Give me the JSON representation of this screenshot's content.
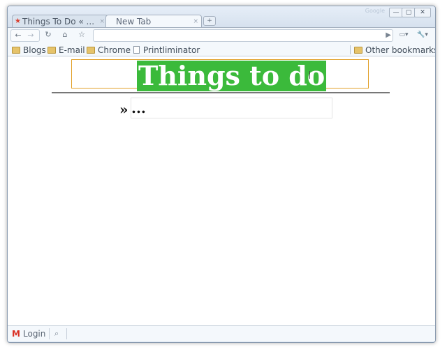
{
  "browser": {
    "brand": "Google",
    "tabs": [
      {
        "label": "Things To Do « ...",
        "close": "×"
      },
      {
        "label": "New Tab",
        "close": "×"
      }
    ],
    "window_buttons": {
      "minimize": "—",
      "maximize": "▢",
      "close": "✕"
    },
    "new_tab_glyph": "+",
    "toolbar": {
      "back": "←",
      "forward": "→",
      "reload": "↻",
      "home": "⌂",
      "star": "☆",
      "go": "▶",
      "page_menu": "▭▾",
      "wrench": "🔧▾"
    },
    "bookmarks": [
      {
        "label": "Blogs",
        "icon": "folder-icon"
      },
      {
        "label": "E-mail",
        "icon": "folder-icon"
      },
      {
        "label": "Chrome",
        "icon": "folder-icon"
      },
      {
        "label": "Printliminator",
        "icon": "page-icon"
      }
    ],
    "other_bookmarks": "Other bookmarks"
  },
  "page": {
    "heading": "Things to do",
    "bullet": "»",
    "task_value": "...",
    "heading_bg": "#3bba3b",
    "frame_color": "#e2a12a"
  },
  "statusbar": {
    "login": "Login",
    "gmail_icon": "M",
    "ext_icon": "⌕"
  }
}
